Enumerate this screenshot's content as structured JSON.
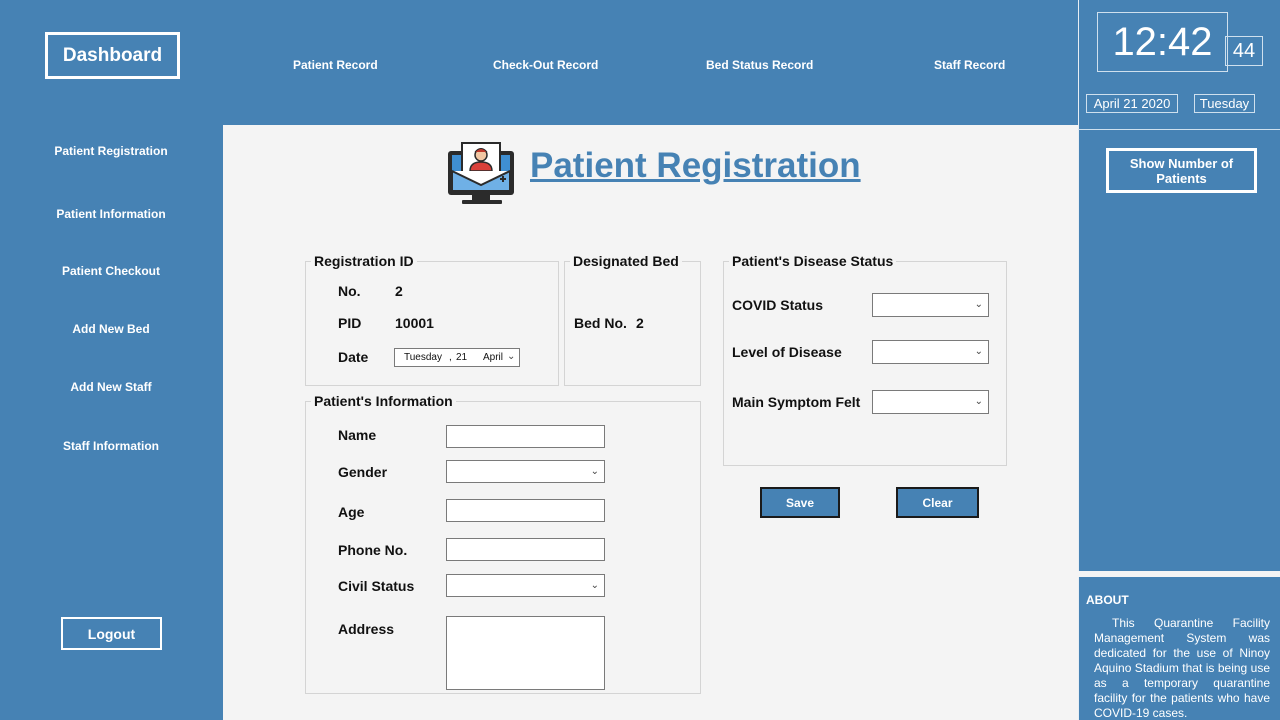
{
  "header": {
    "dashboard_label": "Dashboard",
    "nav": [
      "Patient Record",
      "Check-Out Record",
      "Bed Status Record",
      "Staff Record"
    ]
  },
  "sidebar": {
    "items": [
      "Patient Registration",
      "Patient Information",
      "Patient Checkout",
      "Add New Bed",
      "Add New Staff",
      "Staff Information"
    ],
    "logout_label": "Logout"
  },
  "main": {
    "title": "Patient Registration",
    "title_icon": "patient-monitor-icon",
    "registration": {
      "legend": "Registration ID",
      "no_label": "No.",
      "no_value": "2",
      "pid_label": "PID",
      "pid_value": "10001",
      "date_label": "Date",
      "date_day": "Tuesday",
      "date_num": "21",
      "date_month": "April"
    },
    "bed": {
      "legend": "Designated Bed",
      "label": "Bed No.",
      "value": "2"
    },
    "patient_info": {
      "legend": "Patient's Information",
      "name_label": "Name",
      "gender_label": "Gender",
      "age_label": "Age",
      "phone_label": "Phone No.",
      "civil_label": "Civil Status",
      "address_label": "Address",
      "name_value": "",
      "gender_value": "",
      "age_value": "",
      "phone_value": "",
      "civil_value": "",
      "address_value": ""
    },
    "disease": {
      "legend": "Patient's Disease Status",
      "covid_label": "COVID Status",
      "level_label": "Level of Disease",
      "symptom_label": "Main Symptom Felt",
      "covid_value": "",
      "level_value": "",
      "symptom_value": ""
    },
    "save_label": "Save",
    "clear_label": "Clear"
  },
  "right": {
    "time": "12:42",
    "seconds": "44",
    "date": "April 21 2020",
    "weekday": "Tuesday",
    "show_button": "Show Number of Patients",
    "about_title": "ABOUT",
    "about_text": "This Quarantine Facility Management System was dedicated for the use of Ninoy Aquino Stadium that is being use as a temporary quarantine facility for the patients who have COVID-19 cases."
  },
  "colors": {
    "primary": "#4682b4",
    "panel": "#f4f4f4"
  }
}
